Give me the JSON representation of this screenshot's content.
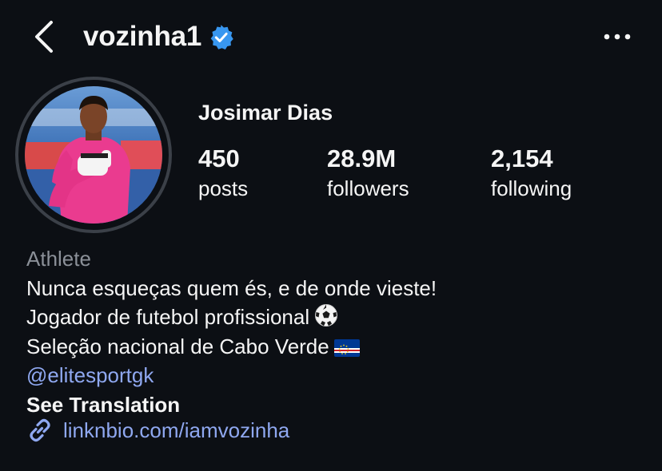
{
  "header": {
    "username": "vozinha1",
    "back_icon": "chevron-left-icon",
    "verified_icon": "verified-badge-icon",
    "more_icon": "more-horizontal-icon"
  },
  "profile": {
    "full_name": "Josimar Dias",
    "stats": {
      "posts": {
        "value": "450",
        "label": "posts"
      },
      "followers": {
        "value": "28.9M",
        "label": "followers"
      },
      "following": {
        "value": "2,154",
        "label": "following"
      }
    }
  },
  "bio": {
    "category": "Athlete",
    "line1": "Nunca esqueças quem és, e de onde vieste!",
    "line2": "Jogador de futebol profissional",
    "line3": "Seleção nacional de Cabo Verde",
    "mention": "@elitesportgk",
    "see_translation": "See Translation",
    "link": "linknbio.com/iamvozinha"
  },
  "colors": {
    "background": "#0c0f14",
    "text": "#f5f5f5",
    "secondary": "#8b9098",
    "link": "#8fa8f0",
    "verified": "#3897f0"
  }
}
